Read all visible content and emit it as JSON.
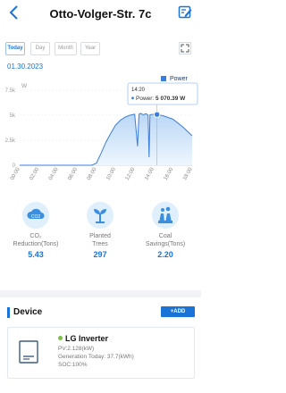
{
  "header": {
    "title": "Otto-Volger-Str. 7c"
  },
  "tabs": [
    {
      "label": "Today",
      "active": true
    },
    {
      "label": "Day",
      "active": false
    },
    {
      "label": "Month",
      "active": false
    },
    {
      "label": "Year",
      "active": false
    }
  ],
  "date": "01.30.2023",
  "chart_data": {
    "type": "area",
    "legend": [
      "Power"
    ],
    "yunit": "W",
    "y_ticks": [
      "0",
      "2.5k",
      "5k",
      "7.5k"
    ],
    "ylim": [
      0,
      7500
    ],
    "x_ticks": [
      "00:00",
      "02:00",
      "04:00",
      "06:00",
      "08:00",
      "10:00",
      "12:00",
      "14:00",
      "16:00",
      "18:00"
    ],
    "series": [
      {
        "name": "Power",
        "x": [
          0,
          2,
          4,
          6,
          7.5,
          8,
          8.5,
          9,
          9.5,
          10,
          10.5,
          11,
          11.5,
          12,
          12.3,
          12.45,
          12.6,
          12.9,
          13.2,
          13.4,
          13.5,
          13.6,
          14,
          14.33,
          15,
          16,
          17,
          18
        ],
        "y": [
          0,
          0,
          0,
          0,
          0,
          200,
          1200,
          2300,
          3200,
          4000,
          4500,
          4800,
          5000,
          5100,
          1900,
          5100,
          5200,
          5050,
          5150,
          5000,
          800,
          5050,
          5100,
          5070.39,
          4950,
          4600,
          3850,
          2950
        ]
      }
    ],
    "tooltip": {
      "time": "14:20",
      "label": "Power: ",
      "value": "5 070.39 W"
    },
    "highlight_x": 14.33,
    "colors": {
      "line": "#3b7ddd",
      "fill": "#cfe4f9",
      "axis": "#c5ccd6"
    }
  },
  "metrics": [
    {
      "icon": "co2-icon",
      "label_lines": [
        "CO₂",
        "Reduction(Tons)"
      ],
      "value": "5.43"
    },
    {
      "icon": "tree-icon",
      "label_lines": [
        "Planted",
        "Trees"
      ],
      "value": "297"
    },
    {
      "icon": "coal-plant-icon",
      "label_lines": [
        "Coal",
        "Savings(Tons)"
      ],
      "value": "2.20"
    }
  ],
  "device_section": {
    "title": "Device",
    "add_label": "+ADD"
  },
  "device": {
    "name": "LG Inverter",
    "status_color": "#7ac043",
    "pv": "PV:2.128(kW)",
    "generation": "Generation Today: 37.7(kWh)",
    "soc": "SOC:100%"
  }
}
